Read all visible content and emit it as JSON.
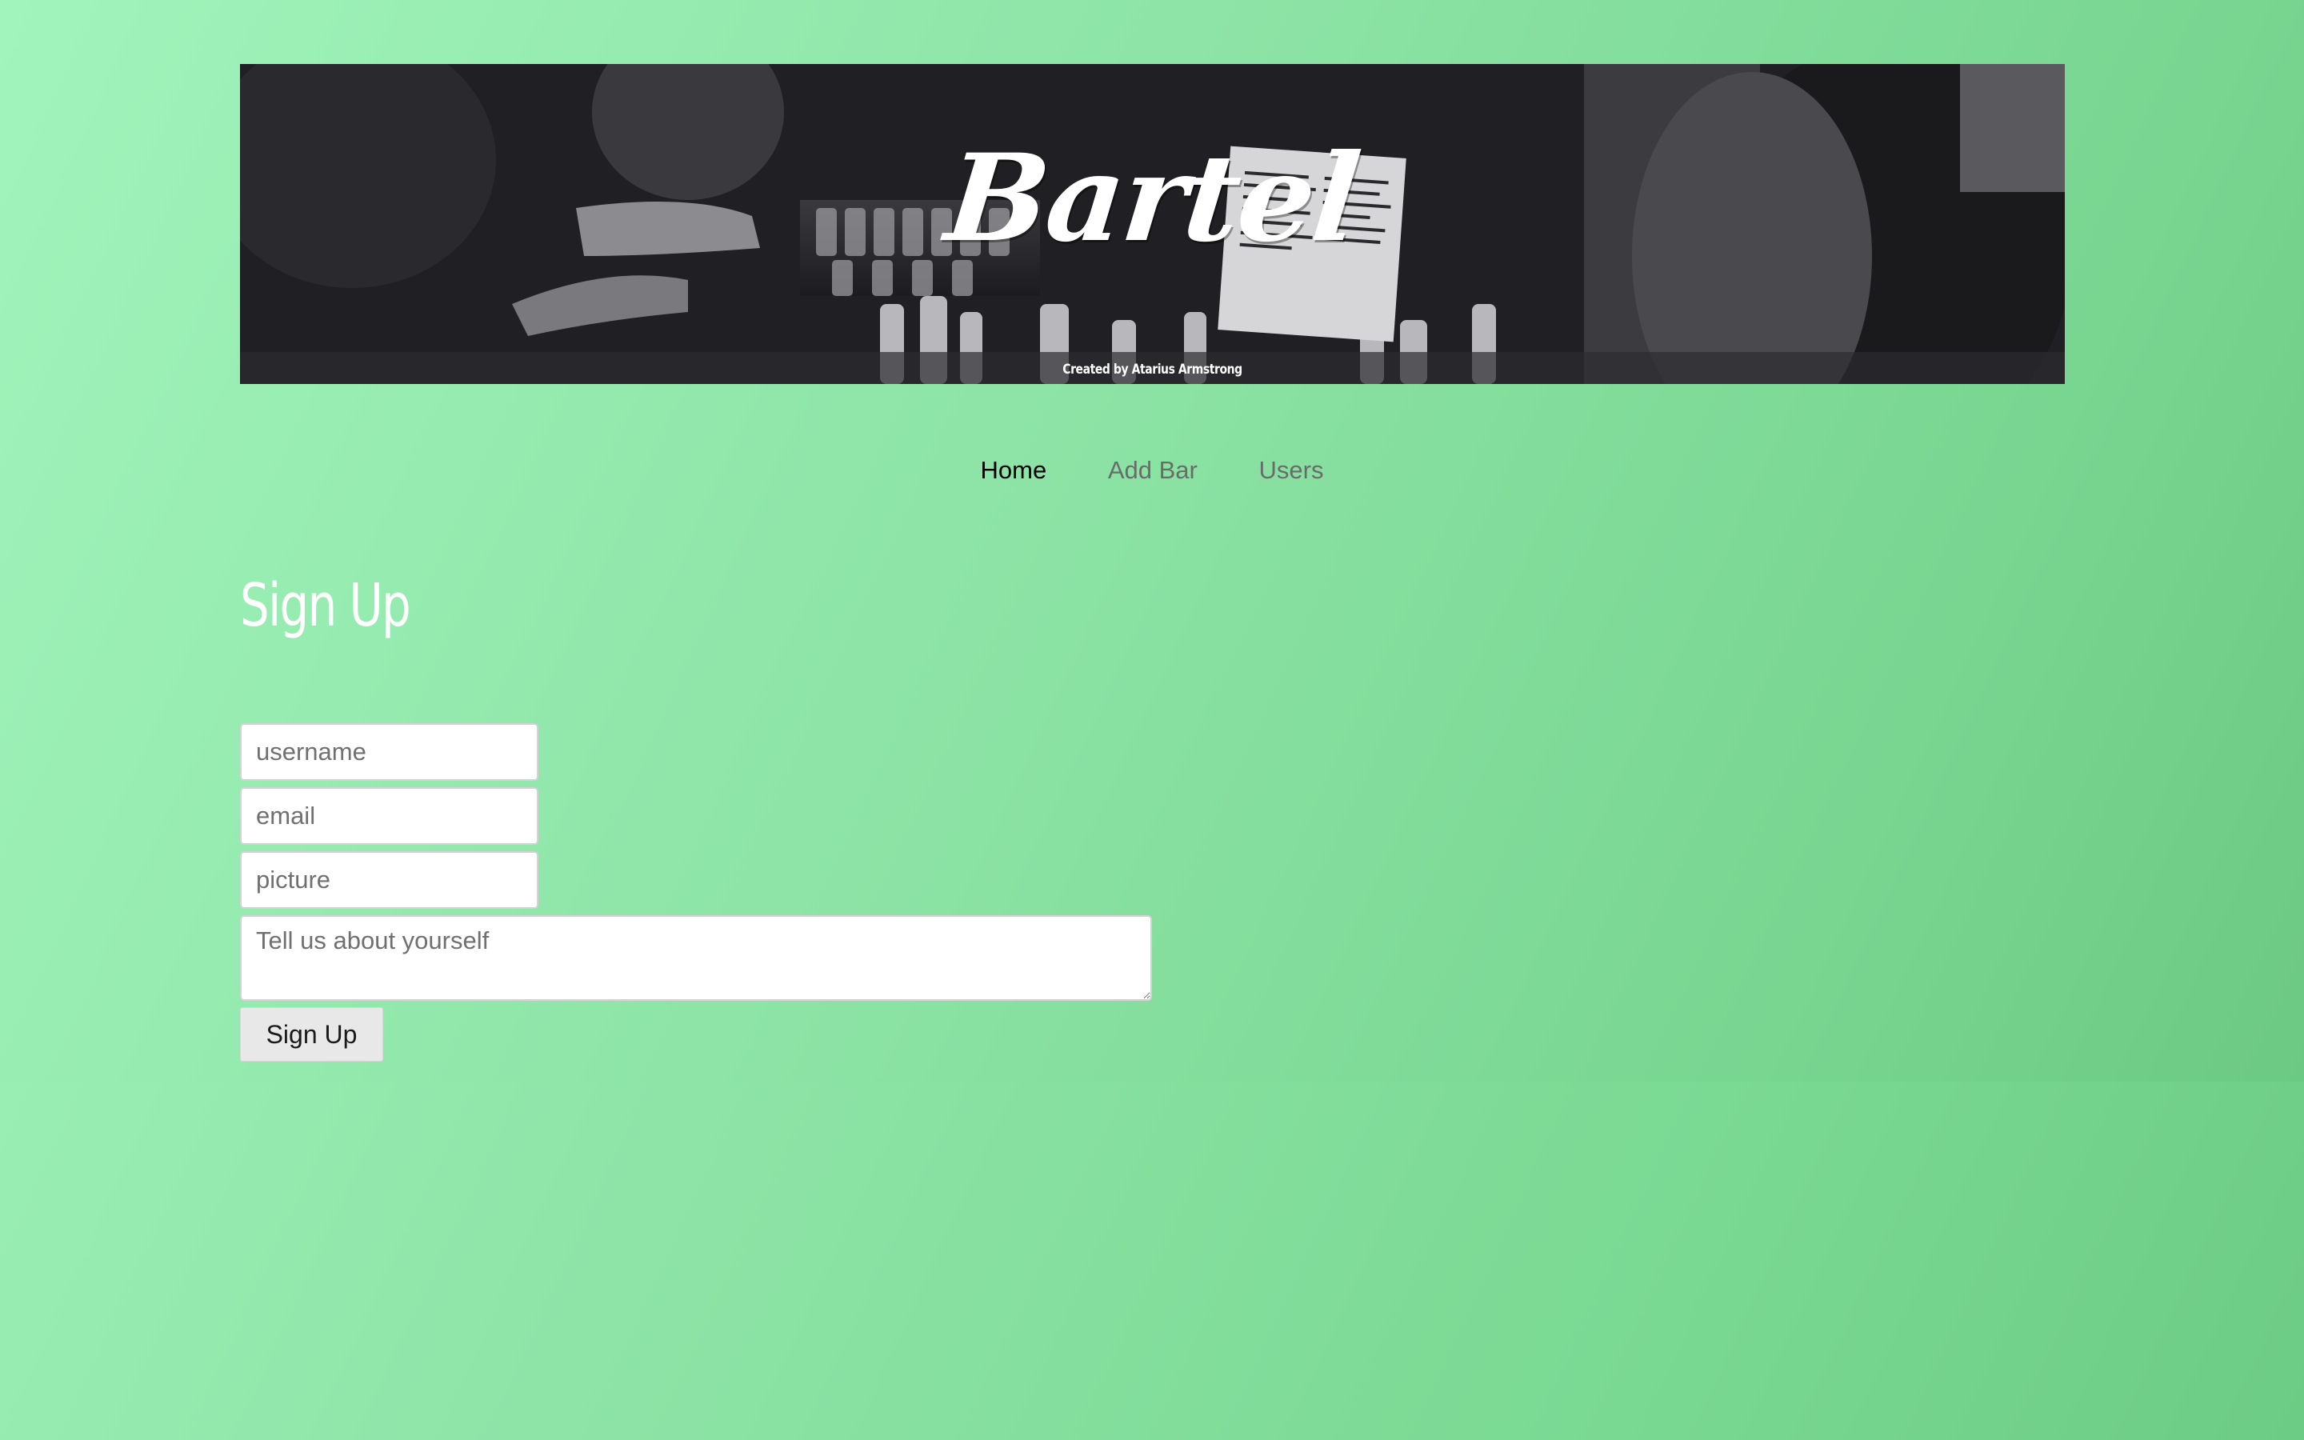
{
  "banner": {
    "title": "Bartel",
    "credit": "Created by Atarius Armstrong"
  },
  "nav": {
    "items": [
      {
        "label": "Home",
        "active": true
      },
      {
        "label": "Add Bar",
        "active": false
      },
      {
        "label": "Users",
        "active": false
      }
    ]
  },
  "page": {
    "heading": "Sign Up"
  },
  "form": {
    "username_placeholder": "username",
    "email_placeholder": "email",
    "picture_placeholder": "picture",
    "bio_placeholder": "Tell us about yourself",
    "submit_label": "Sign Up"
  },
  "colors": {
    "background_gradient_start": "#a1f5bd",
    "background_gradient_end": "#6ccb84",
    "nav_active": "#000000",
    "nav_inactive": "#6b6b6b",
    "heading": "#ffffff"
  }
}
